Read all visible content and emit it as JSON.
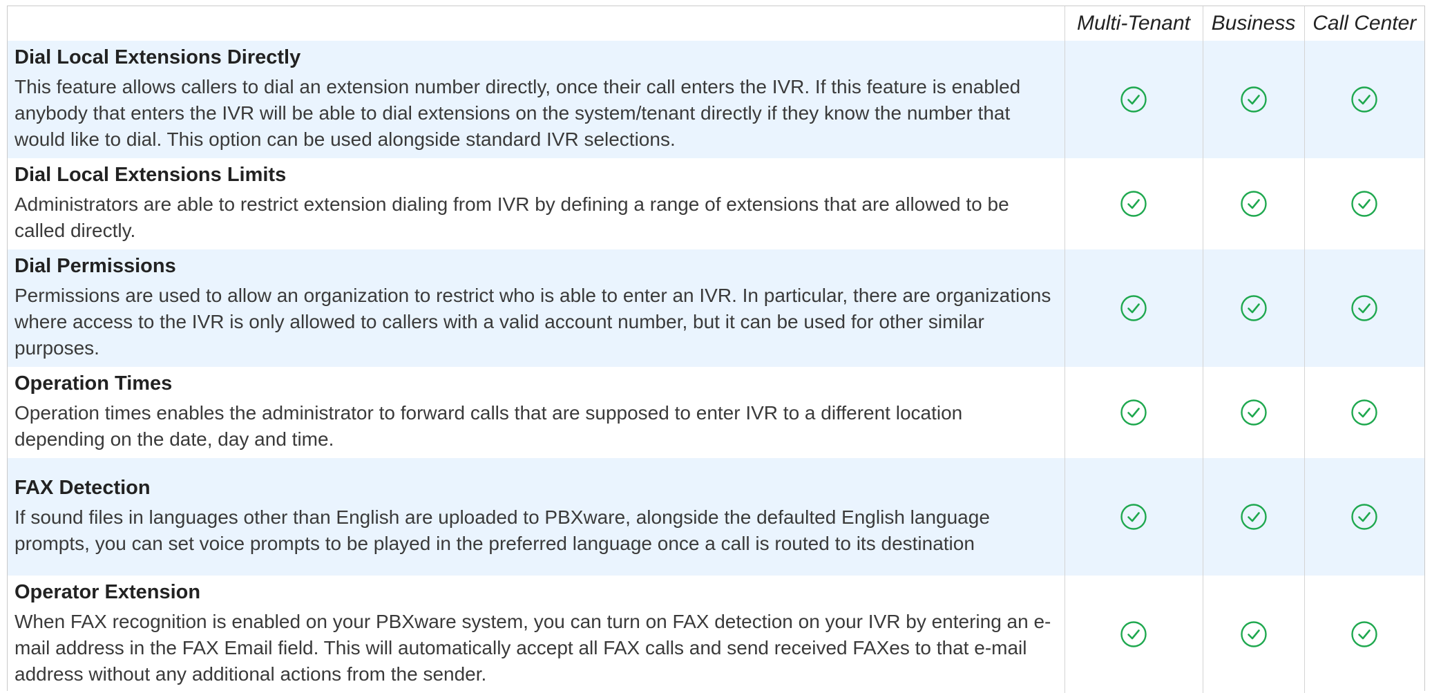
{
  "header": {
    "columns": [
      "Multi-Tenant",
      "Business",
      "Call Center"
    ]
  },
  "colors": {
    "check": "#1fa84f",
    "shaded_row": "#eaf4fe",
    "border": "#d4d4d4"
  },
  "features": [
    {
      "title": "Dial Local Extensions Directly",
      "description": "This feature allows callers to dial an extension number directly, once their call enters the IVR. If this feature is enabled anybody that enters the IVR will be able to dial extensions on the system/tenant directly if they know the number that would like to dial. This option can be used alongside standard IVR selections.",
      "availability": [
        true,
        true,
        true
      ]
    },
    {
      "title": "Dial Local Extensions Limits",
      "description": "Administrators are able to restrict extension dialing from IVR by defining a range of extensions that are allowed to be called directly.",
      "availability": [
        true,
        true,
        true
      ]
    },
    {
      "title": "Dial Permissions",
      "description": "Permissions are used to allow an organization to restrict who is able to enter an IVR. In particular, there are organizations where access to the IVR is only allowed to callers with a valid account number, but it can be used for other similar purposes.",
      "availability": [
        true,
        true,
        true
      ]
    },
    {
      "title": "Operation Times",
      "description": "Operation times enables the administrator to forward calls that are supposed to enter IVR to a different location depending on the date, day and time.",
      "availability": [
        true,
        true,
        true
      ]
    },
    {
      "title": "FAX Detection",
      "description": "If sound files in languages other than English are uploaded to PBXware, alongside the defaulted English language prompts, you can set voice prompts to be played in the preferred language once a call is routed to its destination",
      "availability": [
        true,
        true,
        true
      ]
    },
    {
      "title": "Operator Extension",
      "description": "When FAX recognition is enabled on your PBXware system, you can turn on FAX detection on your IVR by entering an e-mail address in the FAX Email field. This will automatically accept all FAX calls and send received FAXes to that e-mail address without any additional actions from the sender.",
      "availability": [
        true,
        true,
        true
      ]
    }
  ],
  "icons": {
    "available": "check-circle-icon"
  }
}
